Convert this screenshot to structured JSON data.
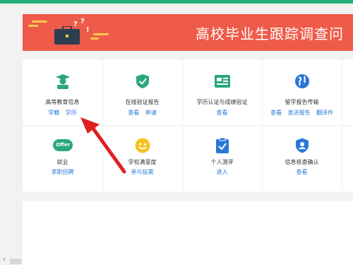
{
  "banner": {
    "title": "高校毕业生跟踪调查问",
    "question_marks": [
      "?",
      "?",
      "!"
    ]
  },
  "services": [
    {
      "label": "高等教育信息",
      "icon": "graduate-icon",
      "links": [
        "学籍",
        "学历"
      ]
    },
    {
      "label": "在线验证报告",
      "icon": "shield-check-icon",
      "links": [
        "查看",
        "申请"
      ]
    },
    {
      "label": "学历认证与成绩验证",
      "icon": "id-card-icon",
      "links": [
        "查看"
      ]
    },
    {
      "label": "留学报告传输",
      "icon": "globe-icon",
      "links": [
        "查看",
        "发送报告",
        "翻译件"
      ]
    },
    {
      "label": "就业",
      "icon": "offer-badge-icon",
      "icon_text": "Offer",
      "links": [
        "求职招聘"
      ]
    },
    {
      "label": "学校满意度",
      "icon": "smiley-icon",
      "links": [
        "参与投票"
      ]
    },
    {
      "label": "个人测评",
      "icon": "clipboard-check-icon",
      "links": [
        "进入"
      ]
    },
    {
      "label": "信息核查确认",
      "icon": "user-shield-icon",
      "links": [
        "查看"
      ]
    }
  ],
  "colors": {
    "top_bar": "#27ae7a",
    "banner": "#ef5b4a",
    "link": "#2a78d6",
    "annotation_arrow": "#e02020"
  }
}
